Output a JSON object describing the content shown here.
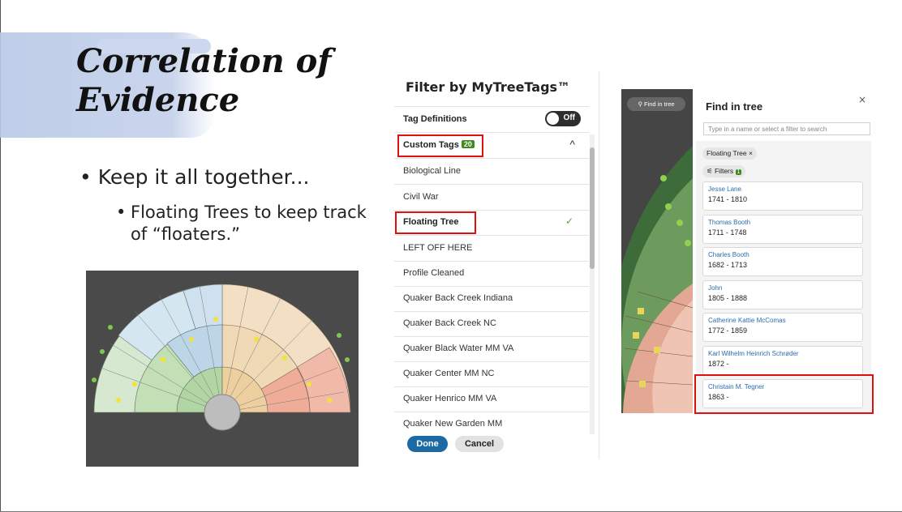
{
  "slide": {
    "title_line1": "Correlation of",
    "title_line2": "Evidence",
    "bullet1": "• Keep it all together...",
    "bullet2_dot": "•",
    "bullet2": "Floating Trees to keep track of “floaters.”"
  },
  "filter_panel": {
    "title": "Filter by MyTreeTags™",
    "tag_definitions_label": "Tag Definitions",
    "toggle_label": "Off",
    "custom_tags_label": "Custom Tags",
    "custom_tags_count": "20",
    "chevron": "^",
    "items": [
      {
        "label": "Biological Line",
        "checked": false
      },
      {
        "label": "Civil War",
        "checked": false
      },
      {
        "label": "Floating Tree",
        "checked": true
      },
      {
        "label": "LEFT OFF HERE",
        "checked": false
      },
      {
        "label": "Profile Cleaned",
        "checked": false
      },
      {
        "label": "Quaker Back Creek Indiana",
        "checked": false
      },
      {
        "label": "Quaker Back Creek NC",
        "checked": false
      },
      {
        "label": "Quaker Black Water MM VA",
        "checked": false
      },
      {
        "label": "Quaker Center MM NC",
        "checked": false
      },
      {
        "label": "Quaker Henrico MM VA",
        "checked": false
      },
      {
        "label": "Quaker New Garden MM",
        "checked": false
      }
    ],
    "check_glyph": "✓",
    "done_label": "Done",
    "cancel_label": "Cancel"
  },
  "find_panel": {
    "find_button_label": "Find in tree",
    "title": "Find in tree",
    "close_glyph": "×",
    "search_placeholder": "Type in a name or select a filter to search",
    "filter_chip": "Floating Tree",
    "filter_chip_close": "×",
    "filters_label": "Filters",
    "filters_count": "1",
    "results": [
      {
        "name": "Jesse Lane",
        "dates": "1741 - 1810"
      },
      {
        "name": "Thomas Booth",
        "dates": "1711 - 1748"
      },
      {
        "name": "Charles Booth",
        "dates": "1682 - 1713"
      },
      {
        "name": "John",
        "dates": "1805 - 1888"
      },
      {
        "name": "Catherine Kattie McComas",
        "dates": "1772 - 1859"
      },
      {
        "name": "Karl Wilhelm Heinrich Schrøder",
        "dates": "1872 -"
      },
      {
        "name": "Christain M. Tegner",
        "dates": "1863 -"
      }
    ]
  },
  "colors": {
    "highlight_red": "#e01010",
    "done_blue": "#1c6aa3",
    "tag_green": "#3f8a1f",
    "link_blue": "#2a6db0"
  }
}
